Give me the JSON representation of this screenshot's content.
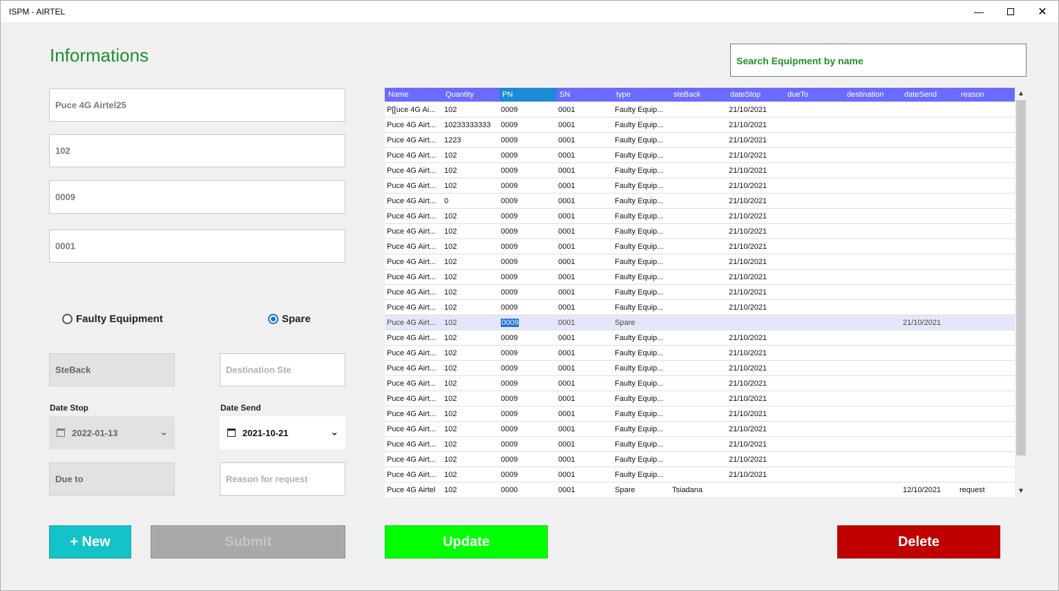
{
  "window": {
    "title": "ISPM - AIRTEL",
    "controls": [
      "minimize",
      "maximize",
      "close"
    ]
  },
  "form": {
    "heading": "Informations",
    "name_value": "Puce 4G Airtel25",
    "quantity_value": "102",
    "pn_value": "0009",
    "sn_value": "0001",
    "radio_faulty": "Faulty Equipment",
    "radio_spare": "Spare",
    "radio_selected": "spare",
    "steback_placeholder": "SteBack",
    "destination_placeholder": "Destination Ste",
    "date_stop_label": "Date Stop",
    "date_stop_value": "2022-01-13",
    "date_send_label": "Date Send",
    "date_send_value": "2021-10-21",
    "due_to_placeholder": "Due to",
    "reason_placeholder": "Reason for request"
  },
  "buttons": {
    "new": "+ New",
    "submit": "Submit",
    "update": "Update",
    "delete": "Delete"
  },
  "colors": {
    "heading": "#1f8f2e",
    "new": "#13c3c8",
    "submit": "#a9a9a9",
    "update": "#00ff00",
    "delete": "#c00000",
    "grid_header": "#6b6bff"
  },
  "search": {
    "placeholder": "Search Equipment by name"
  },
  "grid": {
    "columns": [
      "Name",
      "Quantity",
      "PN",
      "SN",
      "type",
      "steBack",
      "dateStop",
      "dueTo",
      "destination",
      "dateSend",
      "reason"
    ],
    "selected_column": "PN",
    "selected_row": 14,
    "rows": [
      [
        "P[[uce 4G Ai...",
        "102",
        "0009",
        "0001",
        "Faulty Equip...",
        "",
        "21/10/2021",
        "",
        "",
        "",
        ""
      ],
      [
        "Puce 4G Airt...",
        "10233333333",
        "0009",
        "0001",
        "Faulty Equip...",
        "",
        "21/10/2021",
        "",
        "",
        "",
        ""
      ],
      [
        "Puce 4G Airt...",
        "1223",
        "0009",
        "0001",
        "Faulty Equip...",
        "",
        "21/10/2021",
        "",
        "",
        "",
        ""
      ],
      [
        "Puce 4G Airt...",
        "102",
        "0009",
        "0001",
        "Faulty Equip...",
        "",
        "21/10/2021",
        "",
        "",
        "",
        ""
      ],
      [
        "Puce 4G Airt...",
        "102",
        "0009",
        "0001",
        "Faulty Equip...",
        "",
        "21/10/2021",
        "",
        "",
        "",
        ""
      ],
      [
        "Puce 4G Airt...",
        "102",
        "0009",
        "0001",
        "Faulty Equip...",
        "",
        "21/10/2021",
        "",
        "",
        "",
        ""
      ],
      [
        "Puce 4G Airt...",
        "0",
        "0009",
        "0001",
        "Faulty Equip...",
        "",
        "21/10/2021",
        "",
        "",
        "",
        ""
      ],
      [
        "Puce 4G Airt...",
        "102",
        "0009",
        "0001",
        "Faulty Equip...",
        "",
        "21/10/2021",
        "",
        "",
        "",
        ""
      ],
      [
        "Puce 4G Airt...",
        "102",
        "0009",
        "0001",
        "Faulty Equip...",
        "",
        "21/10/2021",
        "",
        "",
        "",
        ""
      ],
      [
        "Puce 4G Airt...",
        "102",
        "0009",
        "0001",
        "Faulty Equip...",
        "",
        "21/10/2021",
        "",
        "",
        "",
        ""
      ],
      [
        "Puce 4G Airt...",
        "102",
        "0009",
        "0001",
        "Faulty Equip...",
        "",
        "21/10/2021",
        "",
        "",
        "",
        ""
      ],
      [
        "Puce 4G Airt...",
        "102",
        "0009",
        "0001",
        "Faulty Equip...",
        "",
        "21/10/2021",
        "",
        "",
        "",
        ""
      ],
      [
        "Puce 4G Airt...",
        "102",
        "0009",
        "0001",
        "Faulty Equip...",
        "",
        "21/10/2021",
        "",
        "",
        "",
        ""
      ],
      [
        "Puce 4G Airt...",
        "102",
        "0009",
        "0001",
        "Faulty Equip...",
        "",
        "21/10/2021",
        "",
        "",
        "",
        ""
      ],
      [
        "Puce 4G Airt...",
        "102",
        "0009",
        "0001",
        "Spare",
        "",
        "",
        "",
        "",
        "21/10/2021",
        ""
      ],
      [
        "Puce 4G Airt...",
        "102",
        "0009",
        "0001",
        "Faulty Equip...",
        "",
        "21/10/2021",
        "",
        "",
        "",
        ""
      ],
      [
        "Puce 4G Airt...",
        "102",
        "0009",
        "0001",
        "Faulty Equip...",
        "",
        "21/10/2021",
        "",
        "",
        "",
        ""
      ],
      [
        "Puce 4G Airt...",
        "102",
        "0009",
        "0001",
        "Faulty Equip...",
        "",
        "21/10/2021",
        "",
        "",
        "",
        ""
      ],
      [
        "Puce 4G Airt...",
        "102",
        "0009",
        "0001",
        "Faulty Equip...",
        "",
        "21/10/2021",
        "",
        "",
        "",
        ""
      ],
      [
        "Puce 4G Airt...",
        "102",
        "0009",
        "0001",
        "Faulty Equip...",
        "",
        "21/10/2021",
        "",
        "",
        "",
        ""
      ],
      [
        "Puce 4G Airt...",
        "102",
        "0009",
        "0001",
        "Faulty Equip...",
        "",
        "21/10/2021",
        "",
        "",
        "",
        ""
      ],
      [
        "Puce 4G Airt...",
        "102",
        "0009",
        "0001",
        "Faulty Equip...",
        "",
        "21/10/2021",
        "",
        "",
        "",
        ""
      ],
      [
        "Puce 4G Airt...",
        "102",
        "0009",
        "0001",
        "Faulty Equip...",
        "",
        "21/10/2021",
        "",
        "",
        "",
        ""
      ],
      [
        "Puce 4G Airt...",
        "102",
        "0009",
        "0001",
        "Faulty Equip...",
        "",
        "21/10/2021",
        "",
        "",
        "",
        ""
      ],
      [
        "Puce 4G Airt...",
        "102",
        "0009",
        "0001",
        "Faulty Equip...",
        "",
        "21/10/2021",
        "",
        "",
        "",
        ""
      ],
      [
        "Puce 4G Airtel",
        "102",
        "0000",
        "0001",
        "Spare",
        "Tsiadana",
        "",
        "",
        "",
        "12/10/2021",
        "request"
      ]
    ]
  }
}
